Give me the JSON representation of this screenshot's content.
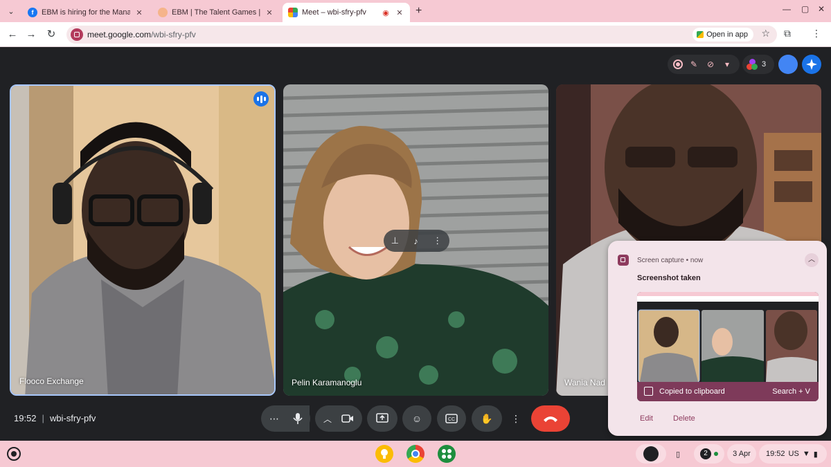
{
  "browser": {
    "tabs": [
      {
        "title": "EBM is hiring for the Managem",
        "favicon": "facebook-icon"
      },
      {
        "title": "EBM | The Talent Games | C-Fa",
        "favicon": "site-icon"
      },
      {
        "title": "Meet – wbi-sfry-pfv",
        "favicon": "meet-icon",
        "active": true
      }
    ],
    "url_host": "meet.google.com",
    "url_path": "/wbi-sfry-pfv",
    "open_in_app_label": "Open in app"
  },
  "meet": {
    "participant_count": "3",
    "participants": [
      {
        "name": "Flooco Exchange"
      },
      {
        "name": "Pelin Karamanoglu"
      },
      {
        "name": "Wania Nad"
      }
    ],
    "time": "19:52",
    "separator": "|",
    "meeting_code": "wbi-sfry-pfv"
  },
  "notification": {
    "source": "Screen capture",
    "when": "now",
    "title": "Screenshot taken",
    "clipboard_label": "Copied to clipboard",
    "shortcut": "Search + V",
    "actions": [
      "Edit",
      "Delete"
    ]
  },
  "shelf": {
    "notification_count": "2",
    "date": "3 Apr",
    "time": "19:52",
    "locale": "US"
  },
  "colors": {
    "accent": "#a8c7fa",
    "end_call": "#ea4335",
    "chrome_bg": "#f6c9d3"
  }
}
